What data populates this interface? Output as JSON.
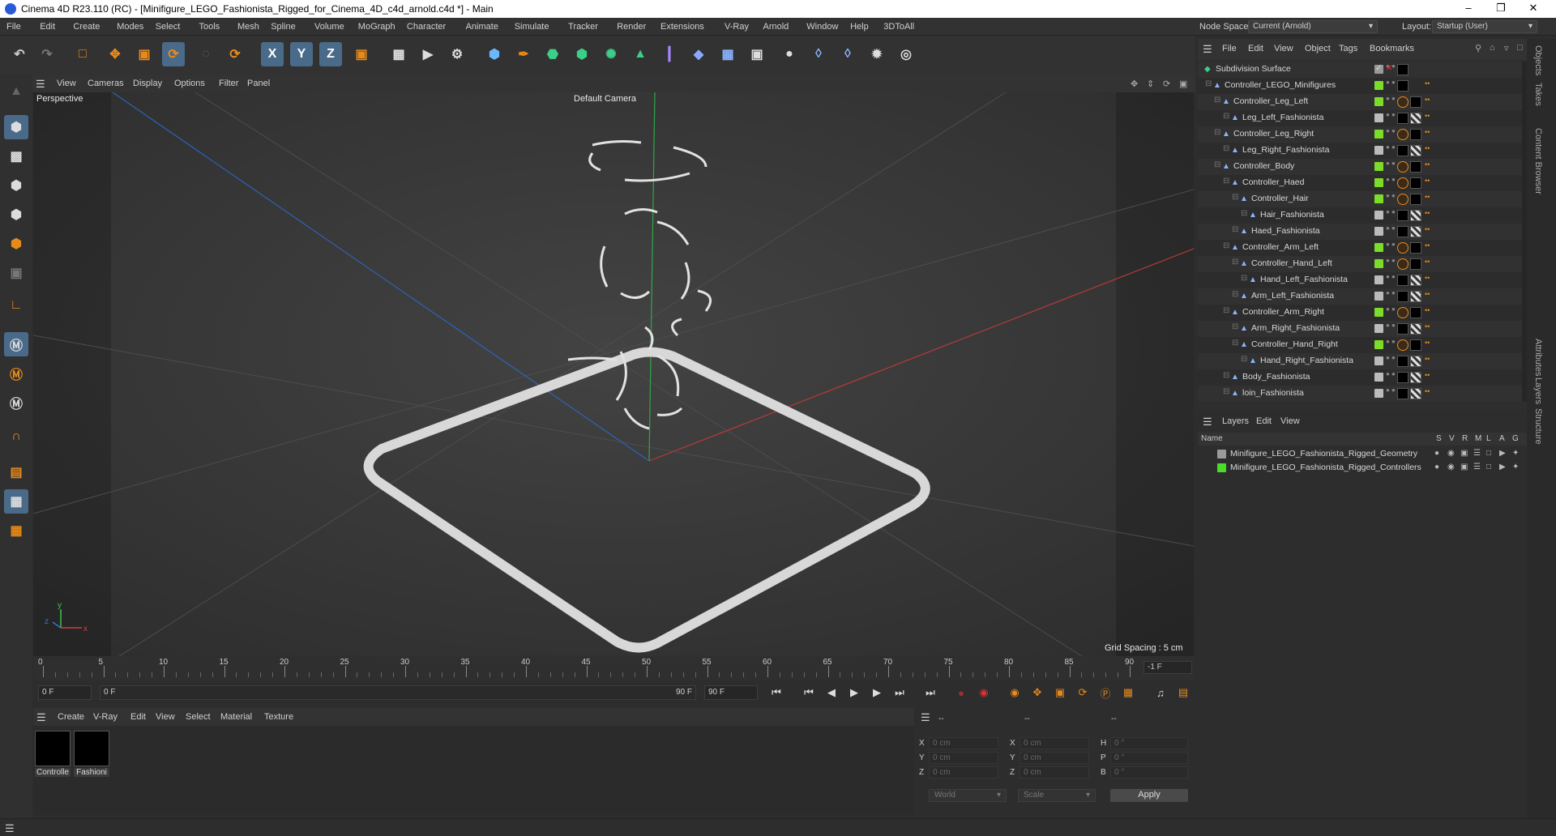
{
  "app": {
    "title": "Cinema 4D R23.110 (RC) - [Minifigure_LEGO_Fashionista_Rigged_for_Cinema_4D_c4d_arnold.c4d *] - Main"
  },
  "menu": [
    "File",
    "Edit",
    "Create",
    "Modes",
    "Select",
    "Tools",
    "Mesh",
    "Spline",
    "Volume",
    "MoGraph",
    "Character",
    "Animate",
    "Simulate",
    "Tracker",
    "Render",
    "Extensions",
    "V-Ray",
    "Arnold",
    "Window",
    "Help",
    "3DToAll"
  ],
  "nodespace": {
    "label": "Node Space:",
    "value": "Current (Arnold)"
  },
  "layout": {
    "label": "Layout:",
    "value": "Startup (User)"
  },
  "toolbar": {
    "x": "X",
    "y": "Y",
    "z": "Z"
  },
  "viewport": {
    "menu": [
      "View",
      "Cameras",
      "Display",
      "Options",
      "Filter",
      "Panel"
    ],
    "name": "Perspective",
    "camera": "Default Camera",
    "grid": "Grid Spacing : 5 cm"
  },
  "timeline": {
    "ticks": [
      "0",
      "5",
      "10",
      "15",
      "20",
      "25",
      "30",
      "35",
      "40",
      "45",
      "50",
      "55",
      "60",
      "65",
      "70",
      "75",
      "80",
      "85",
      "90"
    ],
    "frame_end_box": "-1 F"
  },
  "transport": {
    "start": "0 F",
    "current": "0 F",
    "end_inner": "90 F",
    "end": "90 F"
  },
  "materials": {
    "menu": [
      "Create",
      "V-Ray",
      "Edit",
      "View",
      "Select",
      "Material",
      "Texture"
    ],
    "items": [
      "Controlle",
      "Fashioni"
    ]
  },
  "coords": {
    "hdr": [
      "--",
      "--",
      "--"
    ],
    "rows": [
      {
        "a": "X",
        "av": "0 cm",
        "b": "X",
        "bv": "0 cm",
        "c": "H",
        "cv": "0 °"
      },
      {
        "a": "Y",
        "av": "0 cm",
        "b": "Y",
        "bv": "0 cm",
        "c": "P",
        "cv": "0 °"
      },
      {
        "a": "Z",
        "av": "0 cm",
        "b": "Z",
        "bv": "0 cm",
        "c": "B",
        "cv": "0 °"
      }
    ],
    "world": "World",
    "scale": "Scale",
    "apply": "Apply"
  },
  "objects": {
    "menu": [
      "File",
      "Edit",
      "View",
      "Object",
      "Tags",
      "Bookmarks"
    ],
    "items": [
      {
        "name": "Subdivision Surface",
        "d": 0,
        "c": "#9a9a9a",
        "t": "sds"
      },
      {
        "name": "Controller_LEGO_Minifigures",
        "d": 1,
        "c": "#7cdc2a",
        "t": "o"
      },
      {
        "name": "Controller_Leg_Left",
        "d": 2,
        "c": "#7cdc2a",
        "t": "c"
      },
      {
        "name": "Leg_Left_Fashionista",
        "d": 3,
        "c": "#bbbbbb",
        "t": "m"
      },
      {
        "name": "Controller_Leg_Right",
        "d": 2,
        "c": "#7cdc2a",
        "t": "c"
      },
      {
        "name": "Leg_Right_Fashionista",
        "d": 3,
        "c": "#bbbbbb",
        "t": "m"
      },
      {
        "name": "Controller_Body",
        "d": 2,
        "c": "#7cdc2a",
        "t": "c"
      },
      {
        "name": "Controller_Haed",
        "d": 3,
        "c": "#7cdc2a",
        "t": "c"
      },
      {
        "name": "Controller_Hair",
        "d": 4,
        "c": "#7cdc2a",
        "t": "c"
      },
      {
        "name": "Hair_Fashionista",
        "d": 5,
        "c": "#bbbbbb",
        "t": "m"
      },
      {
        "name": "Haed_Fashionista",
        "d": 4,
        "c": "#bbbbbb",
        "t": "m"
      },
      {
        "name": "Controller_Arm_Left",
        "d": 3,
        "c": "#7cdc2a",
        "t": "c"
      },
      {
        "name": "Controller_Hand_Left",
        "d": 4,
        "c": "#7cdc2a",
        "t": "c"
      },
      {
        "name": "Hand_Left_Fashionista",
        "d": 5,
        "c": "#bbbbbb",
        "t": "m"
      },
      {
        "name": "Arm_Left_Fashionista",
        "d": 4,
        "c": "#bbbbbb",
        "t": "m"
      },
      {
        "name": "Controller_Arm_Right",
        "d": 3,
        "c": "#7cdc2a",
        "t": "c"
      },
      {
        "name": "Arm_Right_Fashionista",
        "d": 4,
        "c": "#bbbbbb",
        "t": "m"
      },
      {
        "name": "Controller_Hand_Right",
        "d": 4,
        "c": "#7cdc2a",
        "t": "c"
      },
      {
        "name": "Hand_Right_Fashionista",
        "d": 5,
        "c": "#bbbbbb",
        "t": "m"
      },
      {
        "name": "Body_Fashionista",
        "d": 3,
        "c": "#bbbbbb",
        "t": "m"
      },
      {
        "name": "loin_Fashionista",
        "d": 3,
        "c": "#bbbbbb",
        "t": "m"
      }
    ]
  },
  "layers": {
    "menu": [
      "Layers",
      "Edit",
      "View"
    ],
    "cols": [
      "Name",
      "S",
      "V",
      "R",
      "M",
      "L",
      "A",
      "G"
    ],
    "items": [
      {
        "name": "Minifigure_LEGO_Fashionista_Rigged_Geometry",
        "c": "#9a9a9a"
      },
      {
        "name": "Minifigure_LEGO_Fashionista_Rigged_Controllers",
        "c": "#4adc2a"
      }
    ]
  },
  "sidetabs": [
    "Objects",
    "Takes",
    "Content Browser",
    "Attributes",
    "Layers",
    "Structure"
  ],
  "colors": {
    "accent": "#4a6a8a",
    "green": "#7cdc2a",
    "orange": "#e88a1a"
  }
}
